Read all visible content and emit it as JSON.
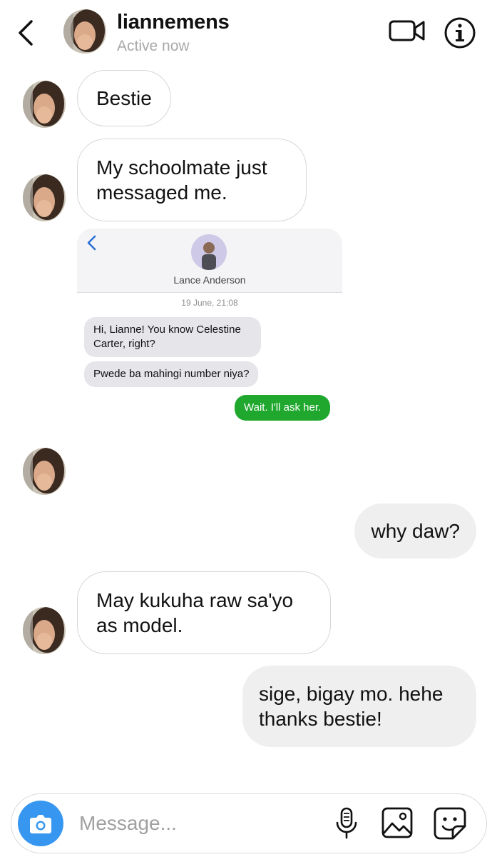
{
  "header": {
    "username": "liannemens",
    "status": "Active now"
  },
  "messages": [
    {
      "from": "them",
      "text": "Bestie"
    },
    {
      "from": "them",
      "text": "My schoolmate just messaged me."
    },
    {
      "from": "them",
      "type": "screenshot"
    },
    {
      "from": "me",
      "text": "why daw?"
    },
    {
      "from": "them",
      "text": "May kukuha raw sa'yo as model."
    },
    {
      "from": "me",
      "text": "sige, bigay mo. hehe thanks bestie!"
    }
  ],
  "screenshot": {
    "contact_name": "Lance Anderson",
    "timestamp": "19 June, 21:08",
    "messages": [
      {
        "from": "them",
        "text": "Hi, Lianne! You know Celestine Carter, right?"
      },
      {
        "from": "them",
        "text": "Pwede ba mahingi number niya?"
      },
      {
        "from": "me",
        "text": "Wait. I'll ask her."
      }
    ]
  },
  "composer": {
    "placeholder": "Message..."
  },
  "icons": {
    "back": "chevron-left-icon",
    "video": "video-camera-icon",
    "info": "info-icon",
    "camera": "camera-icon",
    "mic": "microphone-icon",
    "gallery": "image-icon",
    "sticker": "sticker-icon"
  },
  "colors": {
    "accent": "#3797f0",
    "imessage_green": "#20a82e",
    "outgoing_bubble": "#efefef"
  }
}
